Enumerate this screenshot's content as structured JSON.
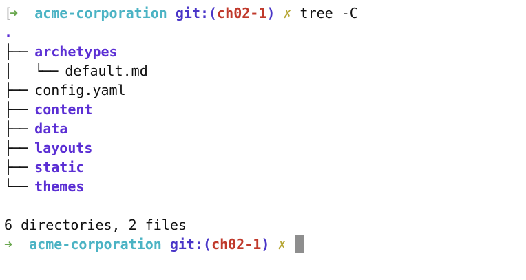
{
  "prompt": {
    "bracket": "[",
    "arrow": "➜",
    "cwd": "acme-corporation",
    "git_label": "git:(",
    "branch": "ch02-1",
    "git_close": ")",
    "dirty_mark": "✗",
    "command": "tree -C"
  },
  "tree": {
    "root": ".",
    "entries": [
      {
        "prefix": "├── ",
        "name": "archetypes",
        "type": "dir"
      },
      {
        "prefix": "│   └── ",
        "name": "default.md",
        "type": "file"
      },
      {
        "prefix": "├── ",
        "name": "config.yaml",
        "type": "file"
      },
      {
        "prefix": "├── ",
        "name": "content",
        "type": "dir"
      },
      {
        "prefix": "├── ",
        "name": "data",
        "type": "dir"
      },
      {
        "prefix": "├── ",
        "name": "layouts",
        "type": "dir"
      },
      {
        "prefix": "├── ",
        "name": "static",
        "type": "dir"
      },
      {
        "prefix": "└── ",
        "name": "themes",
        "type": "dir"
      }
    ],
    "summary": "6 directories, 2 files"
  },
  "prompt2": {
    "arrow": "➜",
    "cwd": "acme-corporation",
    "git_label": "git:(",
    "branch": "ch02-1",
    "git_close": ")",
    "dirty_mark": "✗"
  },
  "colors": {
    "background": "#ffffff",
    "arrow": "#6aa84f",
    "cwd": "#4bb3c4",
    "git": "#4a36c8",
    "branch": "#c0392b",
    "dirty": "#b5a532",
    "directory": "#5b2fd4",
    "cursor": "#8e8e8e"
  }
}
